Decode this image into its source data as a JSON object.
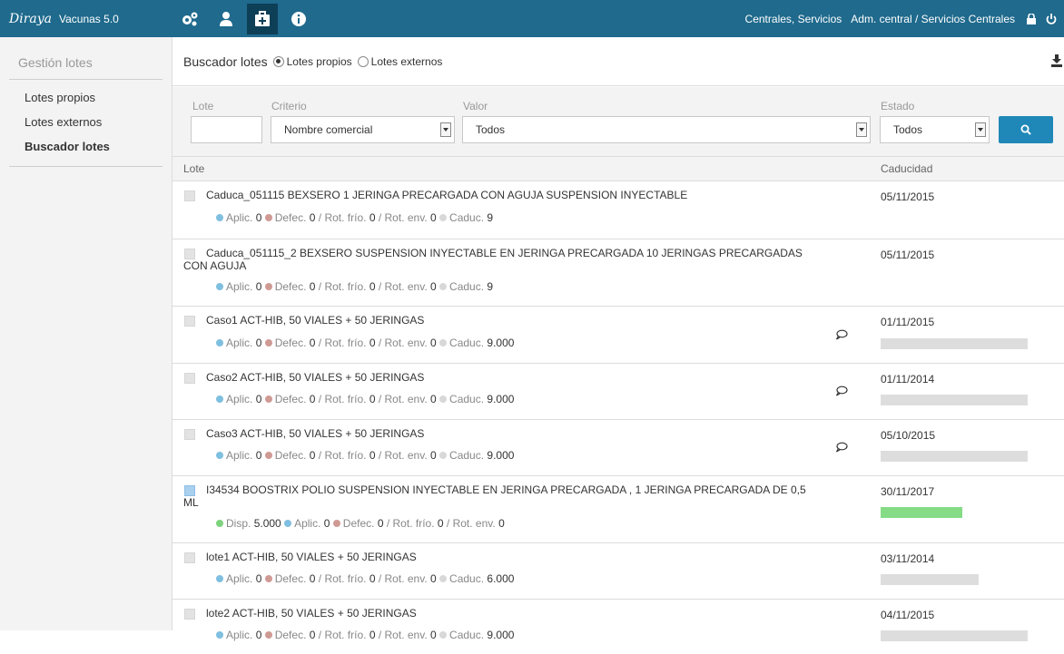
{
  "app": {
    "logo": "Diraya",
    "name": "Vacunas 5.0"
  },
  "topbar": {
    "icons": [
      "gears-icon",
      "user-icon",
      "medical-case-icon",
      "info-icon"
    ],
    "context_1": "Centrales, Servicios",
    "context_2": "Adm. central / Servicios Centrales"
  },
  "sidebar": {
    "title": "Gestión lotes",
    "items": [
      {
        "label": "Lotes propios",
        "active": false
      },
      {
        "label": "Lotes externos",
        "active": false
      },
      {
        "label": "Buscador lotes",
        "active": true
      }
    ]
  },
  "header": {
    "title": "Buscador lotes",
    "radio_propios": "Lotes propios",
    "radio_externos": "Lotes externos",
    "selected": "propios"
  },
  "filters": {
    "lote_label": "Lote",
    "lote_value": "",
    "criterio_label": "Criterio",
    "criterio_value": "Nombre comercial",
    "valor_label": "Valor",
    "valor_value": "Todos",
    "estado_label": "Estado",
    "estado_value": "Todos"
  },
  "table": {
    "col_lote": "Lote",
    "col_caducidad": "Caducidad",
    "labels": {
      "disp": "Disp.",
      "aplic": "Aplic.",
      "defec": "Defec.",
      "rot_frio": "Rot. frío.",
      "rot_env": "Rot. env.",
      "caduc": "Caduc."
    },
    "rows": [
      {
        "name": "Caduca_051115 BEXSERO 1 JERINGA PRECARGADA CON AGUJA SUSPENSION INYECTABLE",
        "aplic": "0",
        "defec": "0",
        "rot_frio": "0",
        "rot_env": "0",
        "caduc": "9",
        "date": "05/11/2015"
      },
      {
        "name": "Caduca_051115_2 BEXSERO SUSPENSION INYECTABLE EN JERINGA PRECARGADA 10 JERINGAS PRECARGADAS CON AGUJA",
        "aplic": "0",
        "defec": "0",
        "rot_frio": "0",
        "rot_env": "0",
        "caduc": "9",
        "date": "05/11/2015"
      },
      {
        "name": "Caso1 ACT-HIB, 50 VIALES + 50 JERINGAS",
        "aplic": "0",
        "defec": "0",
        "rot_frio": "0",
        "rot_env": "0",
        "caduc": "9.000",
        "date": "01/11/2015"
      },
      {
        "name": "Caso2 ACT-HIB, 50 VIALES + 50 JERINGAS",
        "aplic": "0",
        "defec": "0",
        "rot_frio": "0",
        "rot_env": "0",
        "caduc": "9.000",
        "date": "01/11/2014"
      },
      {
        "name": "Caso3 ACT-HIB, 50 VIALES + 50 JERINGAS",
        "aplic": "0",
        "defec": "0",
        "rot_frio": "0",
        "rot_env": "0",
        "caduc": "9.000",
        "date": "05/10/2015"
      },
      {
        "name": "I34534 BOOSTRIX POLIO SUSPENSION INYECTABLE EN JERINGA PRECARGADA , 1 JERINGA PRECARGADA DE 0,5 ML",
        "disp": "5.000",
        "aplic": "0",
        "defec": "0",
        "rot_frio": "0",
        "rot_env": "0",
        "date": "30/11/2017"
      },
      {
        "name": "lote1 ACT-HIB, 50 VIALES + 50 JERINGAS",
        "aplic": "0",
        "defec": "0",
        "rot_frio": "0",
        "rot_env": "0",
        "caduc": "6.000",
        "date": "03/11/2014"
      },
      {
        "name": "lote2 ACT-HIB, 50 VIALES + 50 JERINGAS",
        "aplic": "0",
        "defec": "0",
        "rot_frio": "0",
        "rot_env": "0",
        "caduc": "9.000",
        "date": "04/11/2015"
      }
    ]
  }
}
